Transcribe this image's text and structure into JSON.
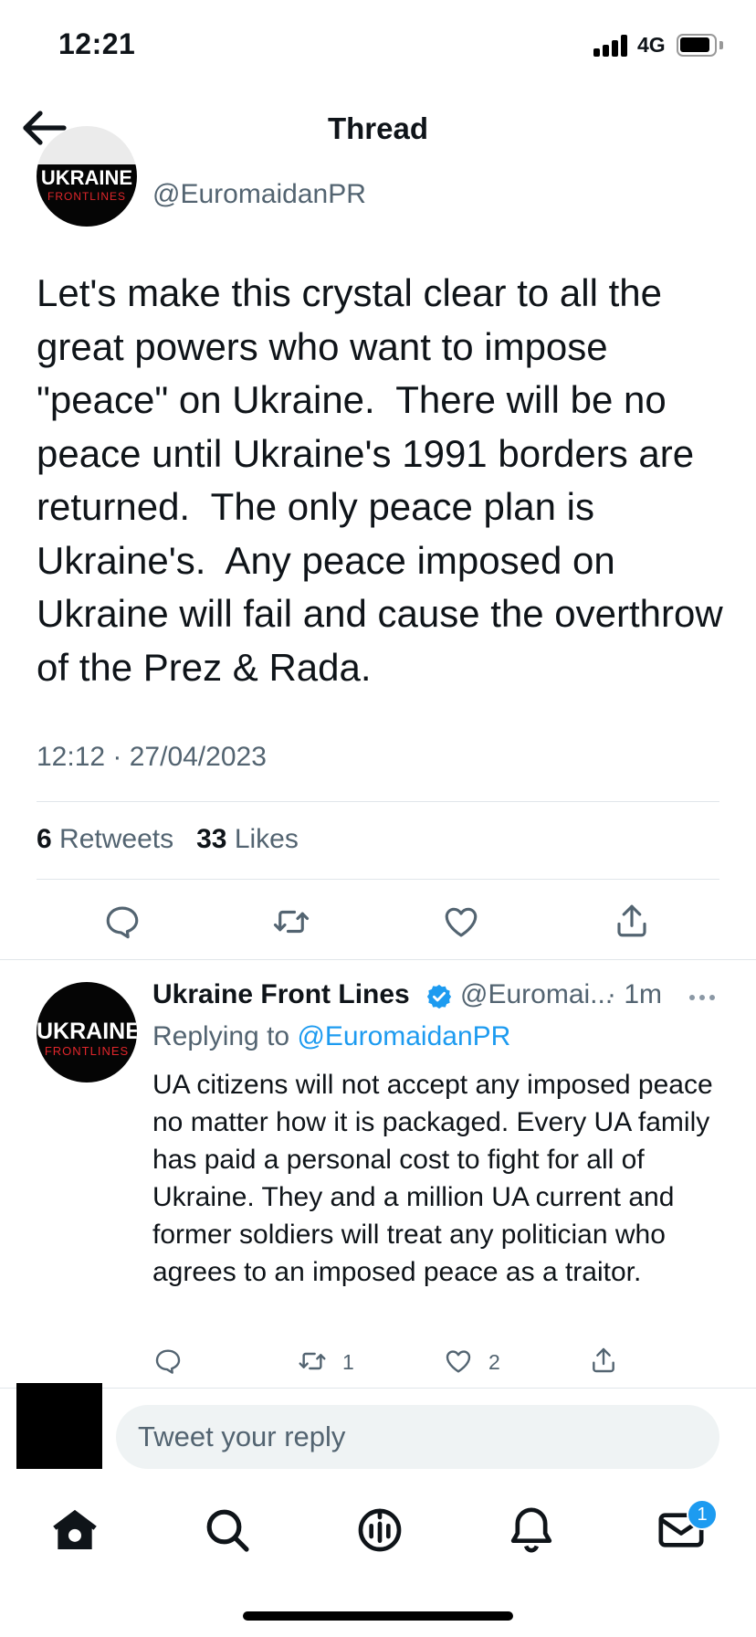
{
  "status_bar": {
    "time": "12:21",
    "network": "4G",
    "icons": [
      "signal-icon",
      "battery-icon"
    ]
  },
  "header": {
    "title": "Thread",
    "back_icon": "arrow-left-icon"
  },
  "main_tweet": {
    "avatar_line1": "UKRAINE",
    "avatar_line2": "FRONTLINES",
    "handle": "@EuromaidanPR",
    "text": "Let's make this crystal clear to all the great powers who want to impose \"peace\" on Ukraine.  There will be no peace until Ukraine's 1991 borders are returned.  The only peace plan is Ukraine's.  Any peace imposed on Ukraine will fail and cause the overthrow of the Prez & Rada.",
    "timestamp": "12:12 · 27/04/2023",
    "retweets_count": "6",
    "retweets_label": "Retweets",
    "likes_count": "33",
    "likes_label": "Likes",
    "action_icons": [
      "reply-icon",
      "retweet-icon",
      "like-icon",
      "share-icon"
    ]
  },
  "reply_tweet": {
    "avatar_line1": "UKRAINE",
    "avatar_line2": "FRONTLINES",
    "name": "Ukraine Front Lines",
    "handle": "@Euromai...",
    "time": "· 1m",
    "replying_prefix": "Replying to",
    "replying_to": "@EuromaidanPR",
    "text": "UA citizens will not accept any imposed peace no matter how it is packaged. Every UA family has paid a personal cost to fight for all of Ukraine. They and a million UA current and former soldiers will treat any politician who agrees to an imposed peace as a traitor.",
    "retweets": "1",
    "likes": "2"
  },
  "compose": {
    "placeholder": "Tweet your reply"
  },
  "tab_bar": {
    "items": [
      "home-icon",
      "search-icon",
      "spaces-icon",
      "notifications-icon",
      "messages-icon"
    ],
    "messages_badge": "1"
  },
  "colors": {
    "accent": "#1d9bf0",
    "secondary_text": "#536471",
    "avatar_red": "#e0262b"
  }
}
